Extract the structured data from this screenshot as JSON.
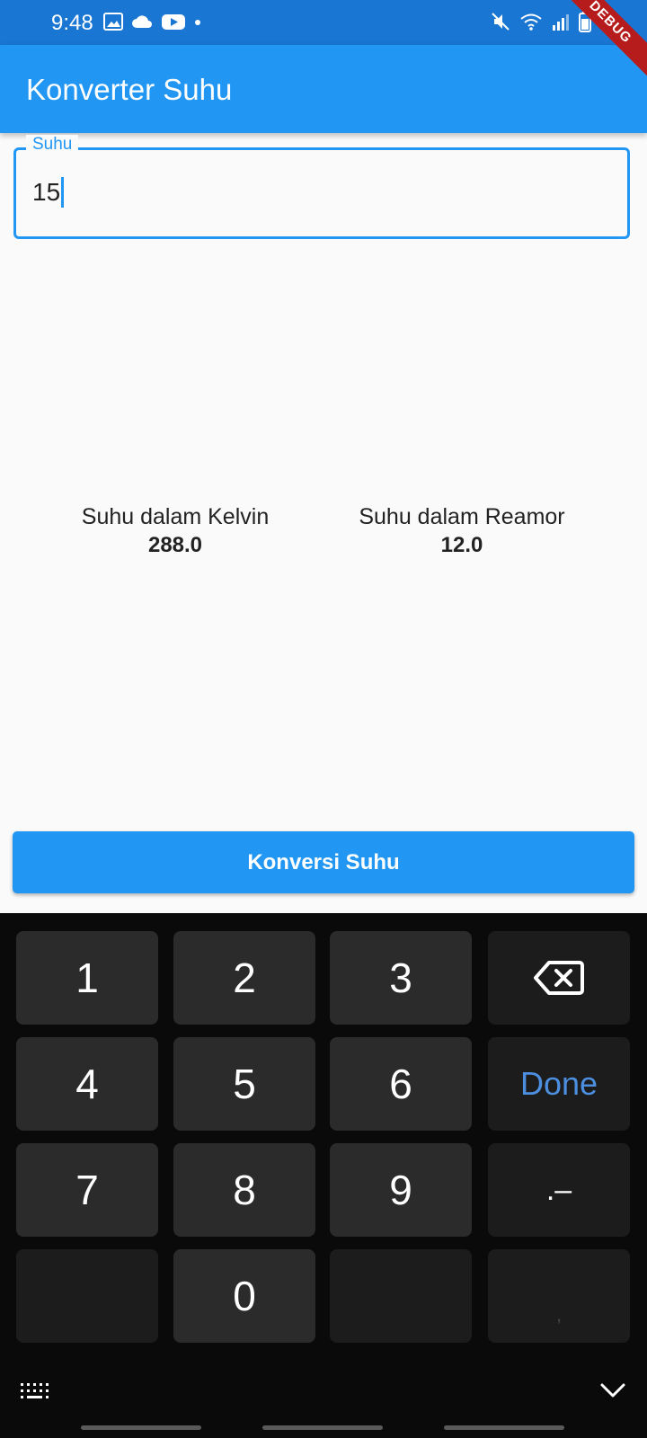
{
  "status_bar": {
    "time": "9:48"
  },
  "debug_banner": "DEBUG",
  "app_bar": {
    "title": "Konverter Suhu"
  },
  "input": {
    "label": "Suhu",
    "value": "15"
  },
  "results": {
    "kelvin": {
      "label": "Suhu dalam Kelvin",
      "value": "288.0"
    },
    "reamur": {
      "label": "Suhu dalam Reamor",
      "value": "12.0"
    }
  },
  "button": {
    "label": "Konversi Suhu"
  },
  "keyboard": {
    "k1": "1",
    "k2": "2",
    "k3": "3",
    "k4": "4",
    "k5": "5",
    "k6": "6",
    "k7": "7",
    "k8": "8",
    "k9": "9",
    "k0": "0",
    "done": "Done",
    "dot_minus": ".–",
    "comma": ","
  },
  "colors": {
    "primary": "#2196f3",
    "status_bar": "#1976d2",
    "keyboard_bg": "#0a0a0a",
    "done_text": "#4c8fe0"
  }
}
